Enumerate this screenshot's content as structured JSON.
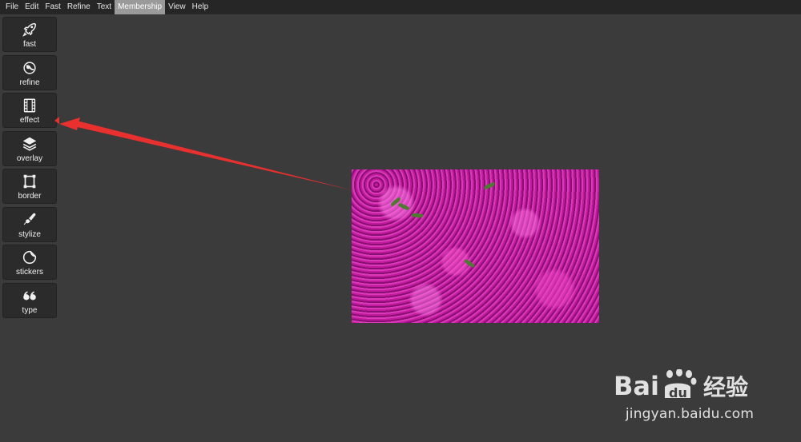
{
  "menubar": {
    "items": [
      {
        "label": "File"
      },
      {
        "label": "Edit"
      },
      {
        "label": "Fast"
      },
      {
        "label": "Refine"
      },
      {
        "label": "Text"
      },
      {
        "label": "Membership",
        "active": true
      },
      {
        "label": "View"
      },
      {
        "label": "Help"
      }
    ]
  },
  "toolbar": {
    "tools": [
      {
        "label": "fast",
        "icon": "rocket-icon"
      },
      {
        "label": "refine",
        "icon": "refine-icon"
      },
      {
        "label": "effect",
        "icon": "film-icon"
      },
      {
        "label": "overlay",
        "icon": "layers-icon"
      },
      {
        "label": "border",
        "icon": "frame-icon"
      },
      {
        "label": "stylize",
        "icon": "brush-icon"
      },
      {
        "label": "stickers",
        "icon": "sticker-icon"
      },
      {
        "label": "type",
        "icon": "quote-icon"
      }
    ]
  },
  "canvas": {
    "image": "pink-flowers-photo"
  },
  "annotation": {
    "color": "#e8302f",
    "points_to": "effect"
  },
  "watermark": {
    "logo_text": "Baidu经验",
    "url": "jingyan.baidu.com"
  },
  "colors": {
    "background": "#3b3b3b",
    "menubar": "#262626",
    "menu_active": "#9a9a9a",
    "tool_button": "#2b2b2b"
  }
}
